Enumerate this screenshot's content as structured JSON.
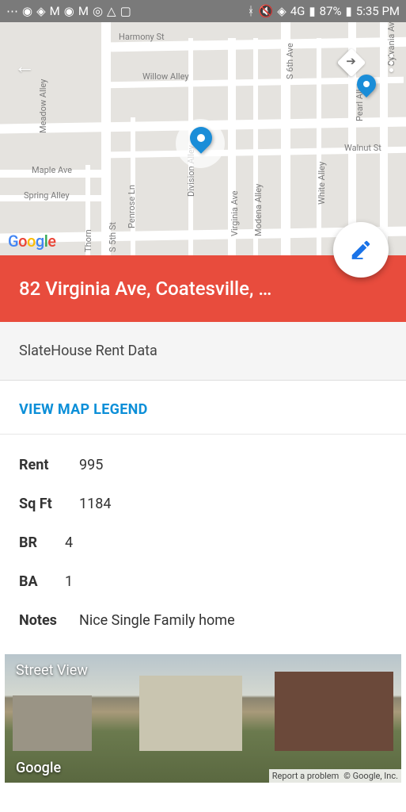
{
  "status_bar": {
    "battery": "87%",
    "time": "5:35 PM",
    "network": "4G"
  },
  "map": {
    "streets": {
      "harmony": "Harmony St",
      "willow": "Willow Alley",
      "walnut": "Walnut St",
      "maple": "Maple Ave",
      "spring": "Spring Alley",
      "penrose": "Penrose Ln",
      "s5th": "S 5th St",
      "division": "Division Alley",
      "virginia": "Virginia Ave",
      "modena": "Modena Alley",
      "s6th": "S 6th Ave",
      "white": "White Alley",
      "pearl": "Pearl Alley",
      "sylvania": "Sylvania Ave",
      "thorn": "Thorn",
      "meadow": "Meadow Alley"
    },
    "logo": "Google"
  },
  "address": "82 Virginia Ave, Coatesville, …",
  "subtitle": "SlateHouse Rent Data",
  "legend_link": "VIEW MAP LEGEND",
  "details": {
    "rent": {
      "label": "Rent",
      "value": "995"
    },
    "sqft": {
      "label": "Sq Ft",
      "value": "1184"
    },
    "br": {
      "label": "BR",
      "value": "4"
    },
    "ba": {
      "label": "BA",
      "value": "1"
    },
    "notes": {
      "label": "Notes",
      "value": "Nice Single Family home"
    }
  },
  "street_view": {
    "label": "Street View",
    "logo": "Google",
    "report": "Report a problem",
    "copyright": "© Google, Inc."
  }
}
